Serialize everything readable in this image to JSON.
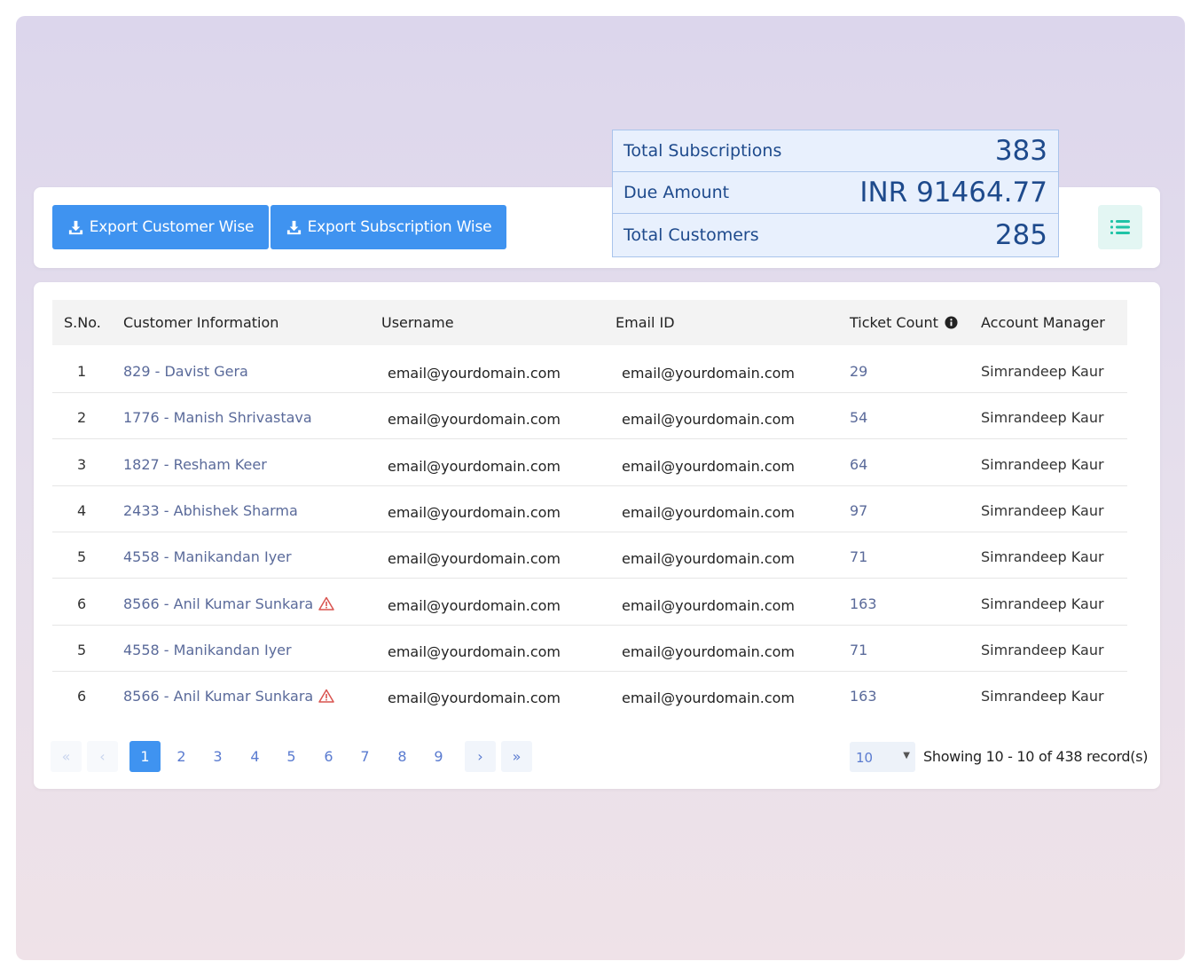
{
  "toolbar": {
    "export_customer_label": "Export Customer Wise",
    "export_subscription_label": "Export Subscription Wise",
    "list_icon": "list-icon",
    "download_icon": "download-icon"
  },
  "summary": {
    "rows": [
      {
        "label": "Total Subscriptions",
        "value": "383"
      },
      {
        "label": "Due Amount",
        "value": "INR 91464.77"
      },
      {
        "label": "Total Customers",
        "value": "285"
      }
    ]
  },
  "table": {
    "headers": {
      "sno": "S.No.",
      "customer": "Customer Information",
      "username": "Username",
      "email": "Email ID",
      "ticket": "Ticket Count",
      "manager": "Account Manager"
    },
    "rows": [
      {
        "sno": "1",
        "customer": "829 - Davist Gera",
        "username": "email@yourdomain.com",
        "email": "email@yourdomain.com",
        "ticket": "29",
        "manager": "Simrandeep Kaur",
        "warning": false
      },
      {
        "sno": "2",
        "customer": "1776 - Manish Shrivastava",
        "username": "email@yourdomain.com",
        "email": "email@yourdomain.com",
        "ticket": "54",
        "manager": "Simrandeep Kaur",
        "warning": false
      },
      {
        "sno": "3",
        "customer": "1827 - Resham Keer",
        "username": "email@yourdomain.com",
        "email": "email@yourdomain.com",
        "ticket": "64",
        "manager": "Simrandeep Kaur",
        "warning": false
      },
      {
        "sno": "4",
        "customer": "2433 - Abhishek Sharma",
        "username": "email@yourdomain.com",
        "email": "email@yourdomain.com",
        "ticket": "97",
        "manager": "Simrandeep Kaur",
        "warning": false
      },
      {
        "sno": "5",
        "customer": "4558 - Manikandan Iyer",
        "username": "email@yourdomain.com",
        "email": "email@yourdomain.com",
        "ticket": "71",
        "manager": "Simrandeep Kaur",
        "warning": false
      },
      {
        "sno": "6",
        "customer": "8566 - Anil Kumar Sunkara",
        "username": "email@yourdomain.com",
        "email": "email@yourdomain.com",
        "ticket": "163",
        "manager": "Simrandeep Kaur",
        "warning": true
      },
      {
        "sno": "5",
        "customer": "4558 - Manikandan Iyer",
        "username": "email@yourdomain.com",
        "email": "email@yourdomain.com",
        "ticket": "71",
        "manager": "Simrandeep Kaur",
        "warning": false
      },
      {
        "sno": "6",
        "customer": "8566 - Anil Kumar Sunkara",
        "username": "email@yourdomain.com",
        "email": "email@yourdomain.com",
        "ticket": "163",
        "manager": "Simrandeep Kaur",
        "warning": true
      }
    ]
  },
  "pagination": {
    "first": "«",
    "prev": "‹",
    "pages": [
      "1",
      "2",
      "3",
      "4",
      "5",
      "6",
      "7",
      "8",
      "9"
    ],
    "active": "1",
    "next": "›",
    "last": "»",
    "page_size": "10",
    "showing": "Showing 10 - 10 of 438 record(s)"
  },
  "colors": {
    "primary_button": "#3f93f0",
    "summary_text": "#1e4a8c",
    "link_text": "#5a6a9a",
    "warning": "#d9534f",
    "list_icon": "#1fc3a6"
  }
}
